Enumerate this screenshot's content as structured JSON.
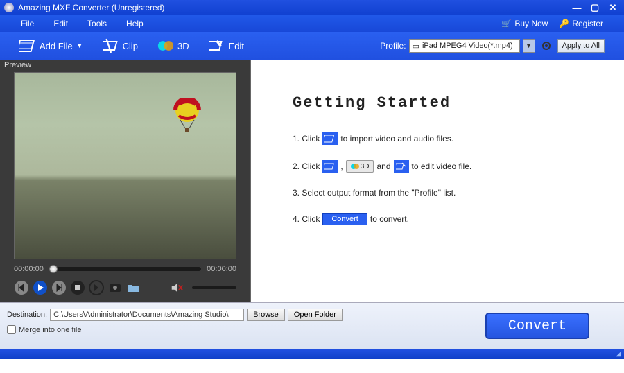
{
  "window": {
    "title": "Amazing MXF Converter (Unregistered)"
  },
  "menu": {
    "file": "File",
    "edit": "Edit",
    "tools": "Tools",
    "help": "Help",
    "buy_now": "Buy Now",
    "register": "Register"
  },
  "toolbar": {
    "add_file": "Add File",
    "clip": "Clip",
    "three_d": "3D",
    "edit": "Edit",
    "profile_label": "Profile:",
    "profile_value": "iPad MPEG4 Video(*.mp4)",
    "apply_all": "Apply to All"
  },
  "preview": {
    "label": "Preview",
    "time_current": "00:00:00",
    "time_total": "00:00:00"
  },
  "getting_started": {
    "heading": "Getting Started",
    "step1_a": "1. Click",
    "step1_b": "to import video and audio files.",
    "step2_a": "2. Click",
    "step2_b": ",",
    "step2_c": "and",
    "step2_d": "to edit video file.",
    "step2_3d": "3D",
    "step3": "3. Select output format from the \"Profile\" list.",
    "step4_a": "4. Click",
    "step4_btn": "Convert",
    "step4_b": "to convert."
  },
  "bottom": {
    "destination_label": "Destination:",
    "destination_path": "C:\\Users\\Administrator\\Documents\\Amazing Studio\\",
    "browse": "Browse",
    "open_folder": "Open Folder",
    "merge_label": "Merge into one file",
    "convert": "Convert"
  }
}
